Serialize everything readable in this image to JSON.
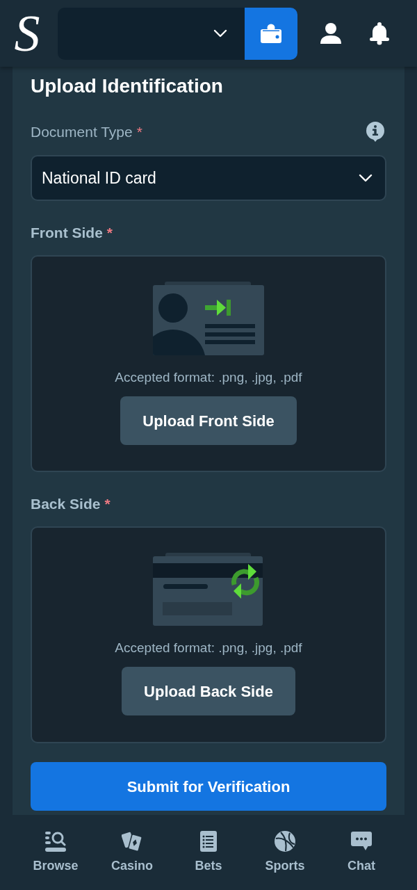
{
  "header": {
    "logo": "S"
  },
  "form": {
    "title": "Upload Identification",
    "document_type": {
      "label": "Document Type",
      "required_mark": "*",
      "value": "National ID card"
    },
    "uploads": [
      {
        "kind": "front",
        "label": "Front Side",
        "required_mark": "*",
        "format_note": "Accepted format: .png, .jpg, .pdf",
        "button": "Upload Front Side"
      },
      {
        "kind": "back",
        "label": "Back Side",
        "required_mark": "*",
        "format_note": "Accepted format: .png, .jpg, .pdf",
        "button": "Upload Back Side"
      }
    ],
    "submit_button": "Submit for Verification"
  },
  "bottom_nav": [
    {
      "kind": "browse",
      "label": "Browse"
    },
    {
      "kind": "casino",
      "label": "Casino"
    },
    {
      "kind": "bets",
      "label": "Bets"
    },
    {
      "kind": "sports",
      "label": "Sports"
    },
    {
      "kind": "chat",
      "label": "Chat"
    }
  ]
}
